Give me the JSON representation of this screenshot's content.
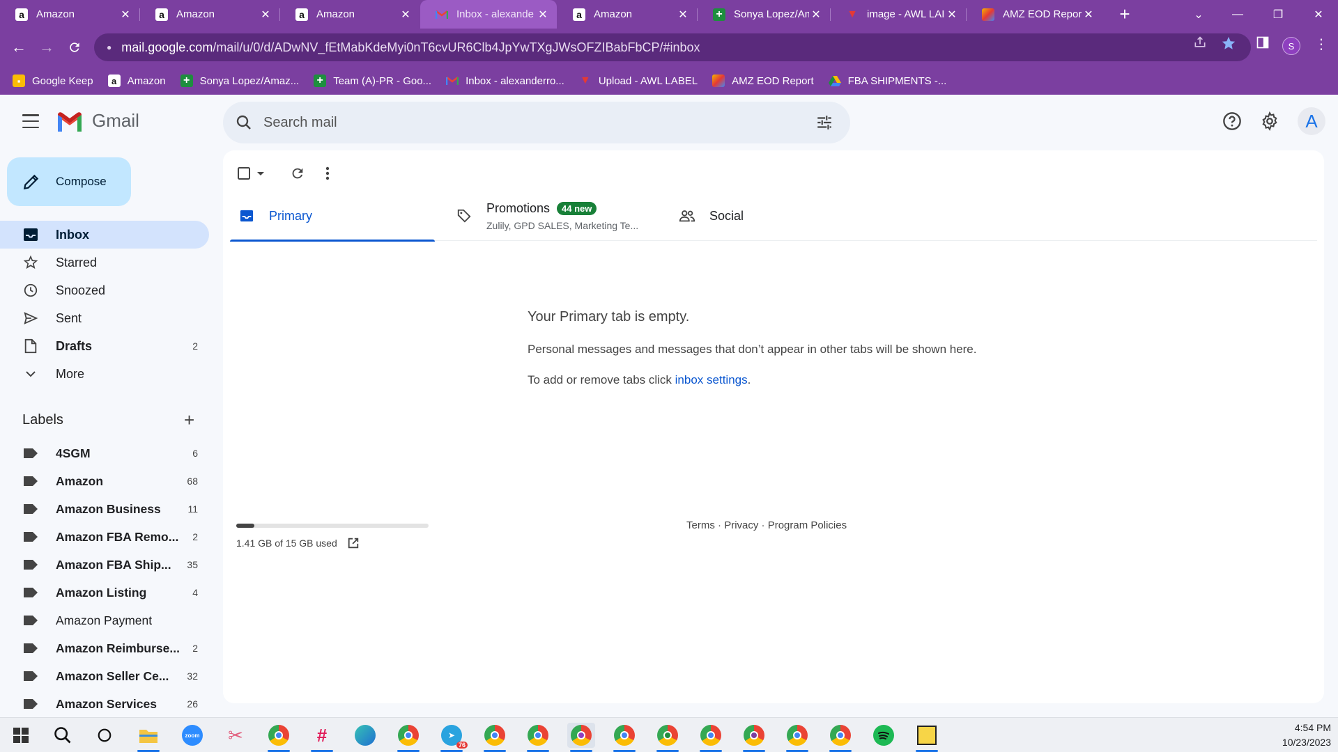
{
  "browser": {
    "tabs": [
      {
        "title": "Amazon",
        "icon": "amazon-icon"
      },
      {
        "title": "Amazon",
        "icon": "amazon-icon"
      },
      {
        "title": "Amazon",
        "icon": "amazon-icon"
      },
      {
        "title": "Inbox - alexande",
        "icon": "gmail-icon",
        "active": true
      },
      {
        "title": "Amazon",
        "icon": "amazon-icon"
      },
      {
        "title": "Sonya Lopez/Am",
        "icon": "google-sheets-icon"
      },
      {
        "title": "image - AWL LAI",
        "icon": "awl-icon"
      },
      {
        "title": "AMZ EOD Repor",
        "icon": "eod-report-icon"
      }
    ],
    "url_host": "mail.google.com",
    "url_path": "/mail/u/0/d/ADwNV_fEtMabKdeMyi0nT6cvUR6Clb4JpYwTXgJWsOFZIBabFbCP/#inbox",
    "profile_letter": "S",
    "bookmarks": [
      {
        "label": "Google Keep",
        "icon": "google-keep-icon"
      },
      {
        "label": "Amazon",
        "icon": "amazon-icon"
      },
      {
        "label": "Sonya Lopez/Amaz...",
        "icon": "google-sheets-icon"
      },
      {
        "label": "Team (A)-PR - Goo...",
        "icon": "google-sheets-icon"
      },
      {
        "label": "Inbox - alexanderro...",
        "icon": "gmail-icon"
      },
      {
        "label": "Upload - AWL LABEL",
        "icon": "awl-icon"
      },
      {
        "label": "AMZ EOD Report",
        "icon": "eod-report-icon"
      },
      {
        "label": "FBA SHIPMENTS -...",
        "icon": "google-drive-icon"
      }
    ]
  },
  "gmail": {
    "logo_text": "Gmail",
    "search_placeholder": "Search mail",
    "avatar_letter": "A",
    "compose_label": "Compose",
    "nav": [
      {
        "label": "Inbox",
        "icon": "inbox-icon",
        "count": "",
        "active": true,
        "bold": true
      },
      {
        "label": "Starred",
        "icon": "star-icon",
        "count": ""
      },
      {
        "label": "Snoozed",
        "icon": "clock-icon",
        "count": ""
      },
      {
        "label": "Sent",
        "icon": "send-icon",
        "count": ""
      },
      {
        "label": "Drafts",
        "icon": "draft-icon",
        "count": "2",
        "bold": true
      },
      {
        "label": "More",
        "icon": "chevron-down-icon",
        "count": ""
      }
    ],
    "labels_heading": "Labels",
    "labels": [
      {
        "label": "4SGM",
        "count": "6",
        "bold": true
      },
      {
        "label": "Amazon",
        "count": "68",
        "bold": true
      },
      {
        "label": "Amazon Business",
        "count": "11",
        "bold": true
      },
      {
        "label": "Amazon FBA Remo...",
        "count": "2",
        "bold": true
      },
      {
        "label": "Amazon FBA Ship...",
        "count": "35",
        "bold": true
      },
      {
        "label": "Amazon Listing",
        "count": "4",
        "bold": true
      },
      {
        "label": "Amazon Payment",
        "count": "",
        "bold": false
      },
      {
        "label": "Amazon Reimburse...",
        "count": "2",
        "bold": true
      },
      {
        "label": "Amazon Seller Ce...",
        "count": "32",
        "bold": true
      },
      {
        "label": "Amazon Services",
        "count": "26",
        "bold": true
      }
    ],
    "tabs": {
      "primary": "Primary",
      "promotions": "Promotions",
      "promotions_badge": "44 new",
      "promotions_sub": "Zulily, GPD SALES, Marketing Te...",
      "social": "Social"
    },
    "empty": {
      "title": "Your Primary tab is empty.",
      "desc": "Personal messages and messages that don’t appear in other tabs will be shown here.",
      "hint_prefix": "To add or remove tabs click ",
      "hint_link": "inbox settings",
      "hint_suffix": "."
    },
    "storage": {
      "text": "1.41 GB of 15 GB used",
      "used_fraction": 0.094
    },
    "footer": {
      "terms": "Terms",
      "sep": " · ",
      "privacy": "Privacy",
      "policies": "Program Policies"
    }
  },
  "taskbar": {
    "time": "4:54 PM",
    "date": "10/23/2023",
    "telegram_badge": "76",
    "zoom_label": "zoom"
  }
}
